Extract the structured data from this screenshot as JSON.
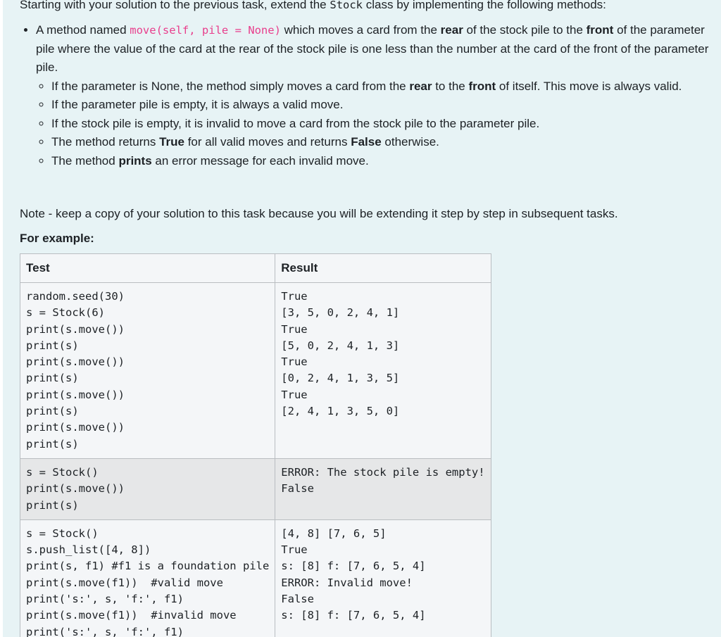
{
  "intro": {
    "text_before": "Starting with your solution to the previous task, extend the ",
    "class_name": "Stock",
    "text_after": " class by implementing the following methods:"
  },
  "bullet": {
    "t1": "A method named ",
    "code": "move(self, pile = None)",
    "t2": " which moves a card from the ",
    "b1": "rear",
    "t3": " of the stock pile to the ",
    "b2": "front",
    "t4": " of the parameter pile where the value of the card at the rear of the stock pile is one less than the number at the card of the front of the parameter pile."
  },
  "sub_bullets": {
    "s1": {
      "t1": "If the parameter is None, the method simply moves a card from the ",
      "b1": "rear",
      "t2": " to the ",
      "b2": "front",
      "t3": " of itself. This move is always valid."
    },
    "s2": {
      "t1": "If the parameter pile is empty, it is always a valid move."
    },
    "s3": {
      "t1": "If the stock pile is empty, it is invalid to move a card from the stock pile to the parameter pile."
    },
    "s4": {
      "t1": "The method returns ",
      "b1": "True",
      "t2": " for all valid moves and returns ",
      "b2": "False",
      "t3": " otherwise."
    },
    "s5": {
      "t1": "The method ",
      "b1": "prints",
      "t2": " an error message for each invalid move."
    }
  },
  "note": "Note - keep a copy of your solution to this task because you will be extending it step by step in subsequent tasks.",
  "example_heading": "For example:",
  "table": {
    "headers": {
      "test": "Test",
      "result": "Result"
    },
    "rows": [
      {
        "test": [
          "random.seed(30)",
          "s = Stock(6)",
          "print(s.move())",
          "print(s)",
          "print(s.move())",
          "print(s)",
          "print(s.move())",
          "print(s)",
          "print(s.move())",
          "print(s)"
        ],
        "result": [
          "True",
          "[3, 5, 0, 2, 4, 1]",
          "True",
          "[5, 0, 2, 4, 1, 3]",
          "True",
          "[0, 2, 4, 1, 3, 5]",
          "True",
          "[2, 4, 1, 3, 5, 0]"
        ]
      },
      {
        "test": [
          "s = Stock()",
          "print(s.move())",
          "print(s)"
        ],
        "result": [
          "ERROR: The stock pile is empty!",
          "False"
        ]
      },
      {
        "test": [
          "s = Stock()",
          "s.push_list([4, 8])",
          "print(s, f1) #f1 is a foundation pile",
          "print(s.move(f1))  #valid move",
          "print('s:', s, 'f:', f1)",
          "print(s.move(f1))  #invalid move",
          "print('s:', s, 'f:', f1)"
        ],
        "result": [
          "[4, 8] [7, 6, 5]",
          "True",
          "s: [8] f: [7, 6, 5, 4]",
          "ERROR: Invalid move!",
          "False",
          "s: [8] f: [7, 6, 5, 4]"
        ]
      }
    ]
  }
}
